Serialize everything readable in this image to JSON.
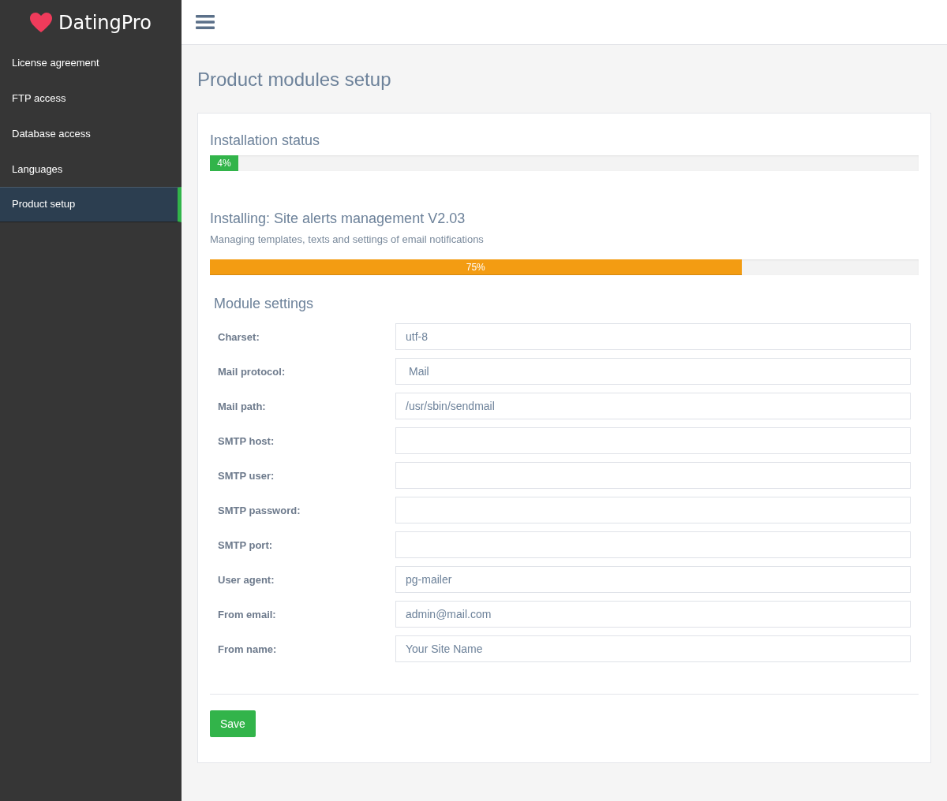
{
  "brand": {
    "name": "DatingPro"
  },
  "sidebar": {
    "items": [
      {
        "label": "License agreement",
        "selected": false
      },
      {
        "label": "FTP access",
        "selected": false
      },
      {
        "label": "Database access",
        "selected": false
      },
      {
        "label": "Languages",
        "selected": false
      },
      {
        "label": "Product setup",
        "selected": true
      }
    ]
  },
  "page_title": "Product modules setup",
  "installation_status": {
    "title": "Installation status",
    "level": 0.04,
    "reading": "4%"
  },
  "installing": {
    "title": "Installing: Site alerts management V2.03",
    "description": "Managing templates, texts and settings of email notifications",
    "level": 0.75,
    "reading": "75%"
  },
  "module_settings": {
    "title": "Module settings",
    "fields": [
      {
        "label": "Charset:",
        "kind": "text",
        "value": "utf-8"
      },
      {
        "label": "Mail protocol:",
        "kind": "select",
        "value": "Mail"
      },
      {
        "label": "Mail path:",
        "kind": "text",
        "value": "/usr/sbin/sendmail"
      },
      {
        "label": "SMTP host:",
        "kind": "text"
      },
      {
        "label": "SMTP user:",
        "kind": "text"
      },
      {
        "label": "SMTP password:",
        "kind": "text"
      },
      {
        "label": "SMTP port:",
        "kind": "text"
      },
      {
        "label": "User agent:",
        "kind": "text",
        "value": "pg-mailer"
      },
      {
        "label": "From email:",
        "kind": "text",
        "value": "admin@mail.com"
      },
      {
        "label": "From name:",
        "kind": "text",
        "value": "Your Site Name"
      }
    ]
  },
  "save_button": "Save"
}
